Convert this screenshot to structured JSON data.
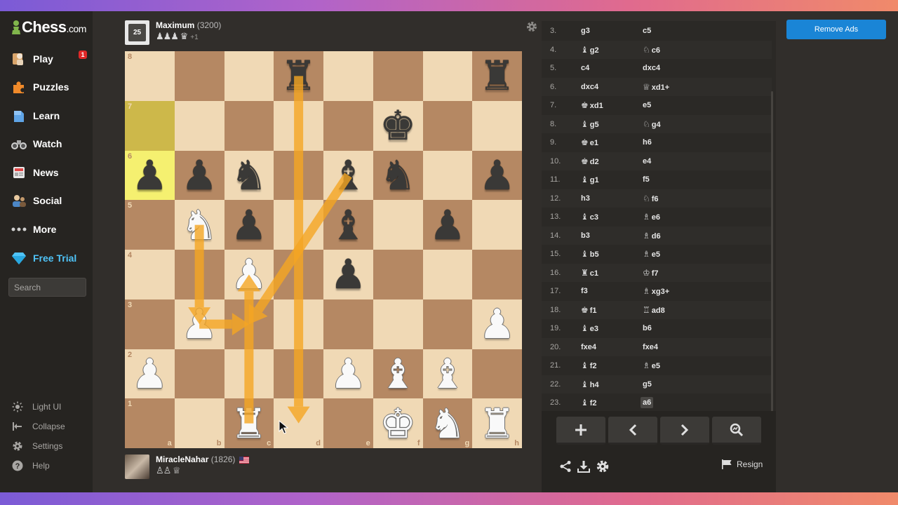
{
  "colors": {
    "light_square": "#f0d9b5",
    "dark_square": "#b58863",
    "highlight_from": "#cdb84a",
    "highlight_to": "#f5f070",
    "arrow": "#f5a623",
    "accent_green": "#81b64c",
    "free_trial": "#4fc3f7",
    "remove_ads": "#1a85d6"
  },
  "sidebar": {
    "logo": {
      "main": "Chess",
      "suffix": ".com"
    },
    "items": [
      {
        "label": "Play",
        "icon": "play-pawn-icon",
        "badge": "1"
      },
      {
        "label": "Puzzles",
        "icon": "puzzle-icon"
      },
      {
        "label": "Learn",
        "icon": "learn-icon"
      },
      {
        "label": "Watch",
        "icon": "binoculars-icon"
      },
      {
        "label": "News",
        "icon": "newspaper-icon"
      },
      {
        "label": "Social",
        "icon": "social-icon"
      },
      {
        "label": "More",
        "icon": "more-dots-icon"
      },
      {
        "label": "Free Trial",
        "icon": "diamond-icon"
      }
    ],
    "search_placeholder": "Search",
    "bottom": [
      {
        "label": "Light UI",
        "icon": "sun-icon"
      },
      {
        "label": "Collapse",
        "icon": "collapse-icon"
      },
      {
        "label": "Settings",
        "icon": "gear-icon"
      },
      {
        "label": "Help",
        "icon": "help-icon"
      }
    ]
  },
  "top_player": {
    "avatar_text": "25",
    "name": "Maximum",
    "rating": "(3200)",
    "captured": "♟♟♟ ♛",
    "advantage": "+1"
  },
  "bottom_player": {
    "name": "MiracleNahar",
    "rating": "(1826)",
    "flag": "us-flag-icon",
    "captured": "♙♙ ♕"
  },
  "board": {
    "ranks": [
      "8",
      "7",
      "6",
      "5",
      "4",
      "3",
      "2",
      "1"
    ],
    "files": [
      "a",
      "b",
      "c",
      "d",
      "e",
      "f",
      "g",
      "h"
    ],
    "highlights": [
      {
        "square": "a7",
        "kind": "from"
      },
      {
        "square": "a6",
        "kind": "to"
      }
    ],
    "pieces": [
      {
        "sq": "d8",
        "c": "b",
        "g": "♜"
      },
      {
        "sq": "h8",
        "c": "b",
        "g": "♜"
      },
      {
        "sq": "f7",
        "c": "b",
        "g": "♚"
      },
      {
        "sq": "a6",
        "c": "b",
        "g": "♟"
      },
      {
        "sq": "b6",
        "c": "b",
        "g": "♟"
      },
      {
        "sq": "c6",
        "c": "b",
        "g": "♞"
      },
      {
        "sq": "e6",
        "c": "b",
        "g": "♝"
      },
      {
        "sq": "f6",
        "c": "b",
        "g": "♞"
      },
      {
        "sq": "h6",
        "c": "b",
        "g": "♟"
      },
      {
        "sq": "b5",
        "c": "w",
        "g": "♞"
      },
      {
        "sq": "c5",
        "c": "b",
        "g": "♟"
      },
      {
        "sq": "e5",
        "c": "b",
        "g": "♝"
      },
      {
        "sq": "g5",
        "c": "b",
        "g": "♟"
      },
      {
        "sq": "c4",
        "c": "w",
        "g": "♟"
      },
      {
        "sq": "e4",
        "c": "b",
        "g": "♟"
      },
      {
        "sq": "b3",
        "c": "w",
        "g": "♟"
      },
      {
        "sq": "h3",
        "c": "w",
        "g": "♟"
      },
      {
        "sq": "a2",
        "c": "w",
        "g": "♟"
      },
      {
        "sq": "e2",
        "c": "w",
        "g": "♟"
      },
      {
        "sq": "f2",
        "c": "w",
        "g": "♝"
      },
      {
        "sq": "g2",
        "c": "w",
        "g": "♝"
      },
      {
        "sq": "c1",
        "c": "w",
        "g": "♜"
      },
      {
        "sq": "f1",
        "c": "w",
        "g": "♚"
      },
      {
        "sq": "g1",
        "c": "w",
        "g": "♞"
      },
      {
        "sq": "h1",
        "c": "w",
        "g": "♜"
      }
    ],
    "arrows": [
      {
        "from": "d8",
        "to": "d1"
      },
      {
        "from": "e6",
        "to": "c3"
      },
      {
        "from": "b5",
        "to": "b3"
      },
      {
        "from": "b3",
        "to": "c3"
      },
      {
        "from": "c1",
        "to": "c4"
      }
    ]
  },
  "moves": [
    {
      "n": "3.",
      "w": "g3",
      "b": "c5"
    },
    {
      "n": "4.",
      "wf": "♝",
      "w": "g2",
      "bf": "♘",
      "b": "c6"
    },
    {
      "n": "5.",
      "w": "c4",
      "b": "dxc4"
    },
    {
      "n": "6.",
      "w": "dxc4",
      "bf": "♕",
      "b": "xd1+"
    },
    {
      "n": "7.",
      "wf": "♚",
      "w": "xd1",
      "b": "e5"
    },
    {
      "n": "8.",
      "wf": "♝",
      "w": "g5",
      "bf": "♘",
      "b": "g4"
    },
    {
      "n": "9.",
      "wf": "♚",
      "w": "e1",
      "b": "h6"
    },
    {
      "n": "10.",
      "wf": "♚",
      "w": "d2",
      "b": "e4"
    },
    {
      "n": "11.",
      "wf": "♝",
      "w": "g1",
      "b": "f5"
    },
    {
      "n": "12.",
      "w": "h3",
      "bf": "♘",
      "b": "f6"
    },
    {
      "n": "13.",
      "wf": "♝",
      "w": "c3",
      "bf": "♗",
      "b": "e6"
    },
    {
      "n": "14.",
      "w": "b3",
      "bf": "♗",
      "b": "d6"
    },
    {
      "n": "15.",
      "wf": "♝",
      "w": "b5",
      "bf": "♗",
      "b": "e5"
    },
    {
      "n": "16.",
      "wf": "♜",
      "w": "c1",
      "bf": "♔",
      "b": "f7"
    },
    {
      "n": "17.",
      "w": "f3",
      "bf": "♗",
      "b": "xg3+"
    },
    {
      "n": "18.",
      "wf": "♚",
      "w": "f1",
      "bf": "♖",
      "b": "ad8"
    },
    {
      "n": "19.",
      "wf": "♝",
      "w": "e3",
      "b": "b6"
    },
    {
      "n": "20.",
      "w": "fxe4",
      "b": "fxe4"
    },
    {
      "n": "21.",
      "wf": "♝",
      "w": "f2",
      "bf": "♗",
      "b": "e5"
    },
    {
      "n": "22.",
      "wf": "♝",
      "w": "h4",
      "b": "g5"
    },
    {
      "n": "23.",
      "wf": "♝",
      "w": "f2",
      "b": "a6",
      "current": true
    }
  ],
  "controls": {
    "add": "+",
    "prev": "‹",
    "next": "›",
    "analyze": "analysis-icon"
  },
  "resign_label": "Resign",
  "remove_ads_label": "Remove Ads"
}
